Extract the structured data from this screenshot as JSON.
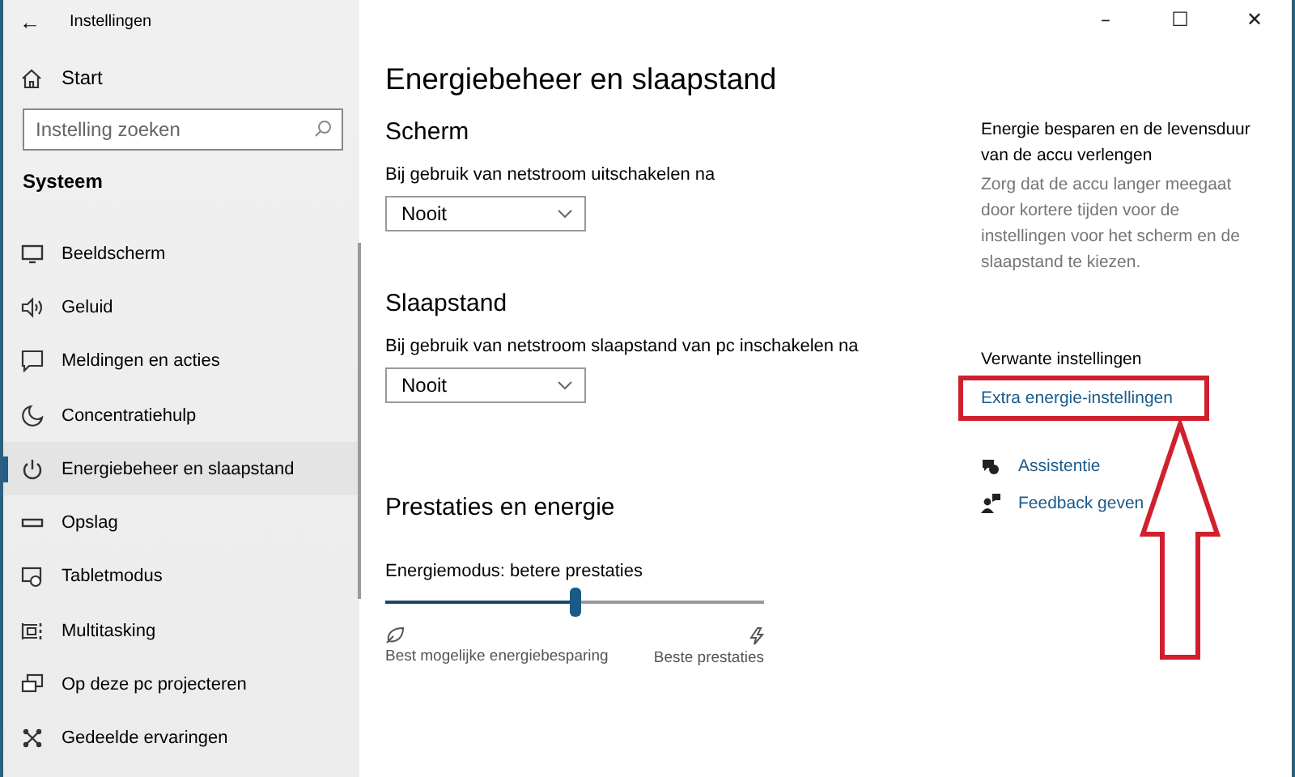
{
  "window": {
    "title": "Instellingen",
    "back": "←",
    "controls": [
      "–",
      "☐",
      "✕"
    ]
  },
  "sidebar": {
    "home": "Start",
    "search": {
      "placeholder": "Instelling zoeken"
    },
    "section": "Systeem",
    "items": [
      {
        "label": "Beeldscherm",
        "selected": false
      },
      {
        "label": "Geluid",
        "selected": false
      },
      {
        "label": "Meldingen en acties",
        "selected": false
      },
      {
        "label": "Concentratiehulp",
        "selected": false
      },
      {
        "label": "Energiebeheer en slaapstand",
        "selected": true
      },
      {
        "label": "Opslag",
        "selected": false
      },
      {
        "label": "Tabletmodus",
        "selected": false
      },
      {
        "label": "Multitasking",
        "selected": false
      },
      {
        "label": "Op deze pc projecteren",
        "selected": false
      },
      {
        "label": "Gedeelde ervaringen",
        "selected": false
      }
    ]
  },
  "page": {
    "title": "Energiebeheer en slaapstand",
    "sections": [
      {
        "heading": "Scherm",
        "label": "Bij gebruik van netstroom uitschakelen na",
        "value": "Nooit"
      },
      {
        "heading": "Slaapstand",
        "label": "Bij gebruik van netstroom slaapstand van pc inschakelen na",
        "value": "Nooit"
      }
    ],
    "performance": {
      "heading": "Prestaties en energie",
      "label": "Energiemodus: betere prestaties",
      "level": 0.5,
      "min_label": "Best mogelijke energiebesparing",
      "max_label": "Beste prestaties"
    }
  },
  "related": {
    "tip_title": "Energie besparen en de levensduur van de accu verlengen",
    "tip_text": "Zorg dat de accu langer meegaat door kortere tijden voor de instellingen voor het scherm en de slaapstand te kiezen.",
    "heading": "Verwante instellingen",
    "link": "Extra energie-instellingen",
    "help": [
      "Assistentie",
      "Feedback geven"
    ]
  }
}
